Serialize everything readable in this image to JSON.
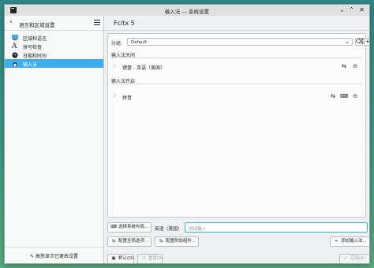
{
  "window": {
    "title": "输入法 — 系统设置"
  },
  "sidebar": {
    "title": "语言和区域设置",
    "items": [
      {
        "label": "区域和语言",
        "icon": "region-icon",
        "selected": false
      },
      {
        "label": "拼写检查",
        "icon": "spellcheck-icon",
        "selected": false
      },
      {
        "label": "日期和时间",
        "icon": "clock-icon",
        "selected": false
      },
      {
        "label": "输入法",
        "icon": "input-method-icon",
        "selected": true
      }
    ],
    "footer_label": "高亮显示已更改设置"
  },
  "main": {
    "title": "Fcitx 5",
    "group_label": "分组:",
    "group_value": "Default",
    "section_off": "输入法关闭",
    "section_on": "输入法开启",
    "input_methods_off": [
      {
        "name": "键盘 - 英语（美国）"
      }
    ],
    "input_methods_on": [
      {
        "name": "拼音"
      }
    ]
  },
  "bottom": {
    "select_layout_btn": "选择系统布局...",
    "layout_label": "英语（美国）",
    "test_input_placeholder": "测试输入",
    "global_options_btn": "配置全局选项...",
    "addons_btn": "配置附加组件...",
    "add_im_btn": "添加输入法...",
    "defaults_btn": "默认(D)",
    "reset_btn": "重置(R)",
    "apply_btn": "应用(A)"
  },
  "colors": {
    "accent": "#3daee9",
    "window_bg": "#eff0f1"
  }
}
